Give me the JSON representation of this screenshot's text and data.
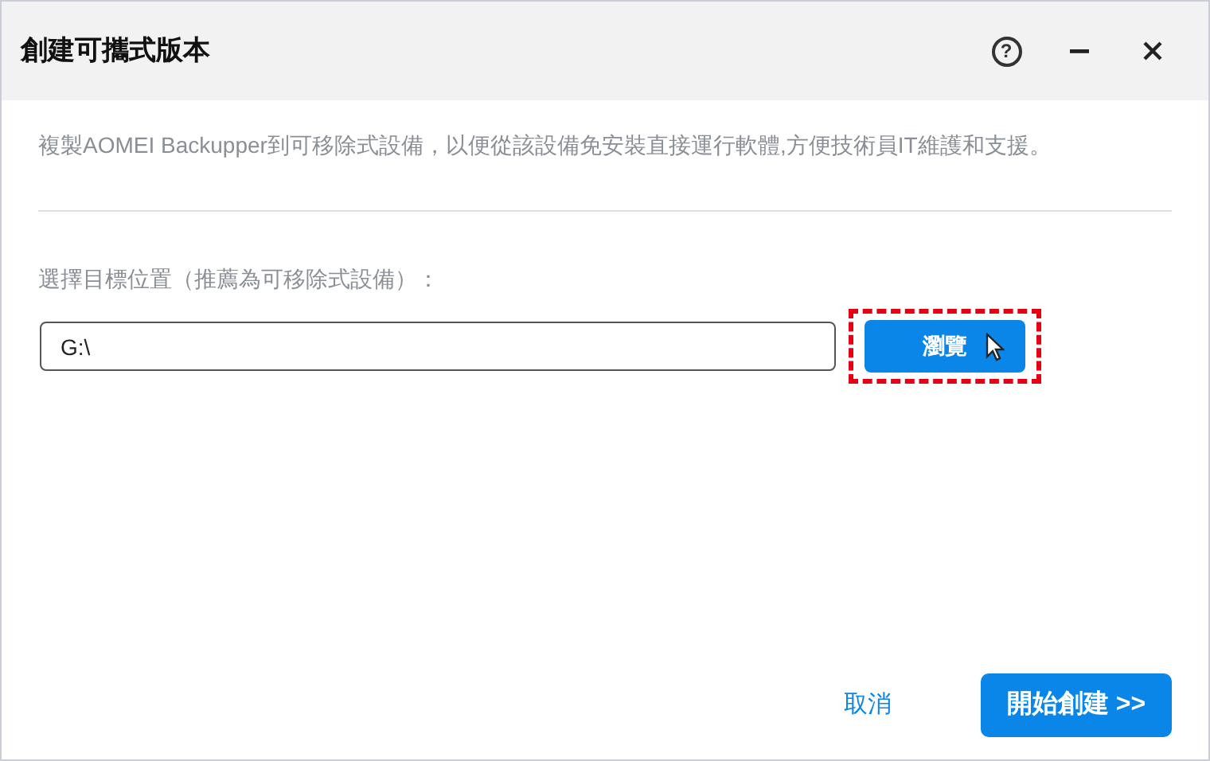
{
  "window": {
    "title": "創建可攜式版本",
    "buttons": [
      {
        "kind": "help",
        "label": "?"
      },
      {
        "kind": "minimize"
      },
      {
        "kind": "close"
      }
    ]
  },
  "description": "複製AOMEI Backupper到可移除式設備，以便從該設備免安裝直接運行軟體,方便技術員IT維護和支援。",
  "target": {
    "label": "選擇目標位置（推薦為可移除式設備）：",
    "value": "G:\\",
    "browse_button": {
      "label": "瀏覽",
      "highlighted": true
    }
  },
  "footer": {
    "cancel": "取消",
    "start": "開始創建 >>"
  }
}
